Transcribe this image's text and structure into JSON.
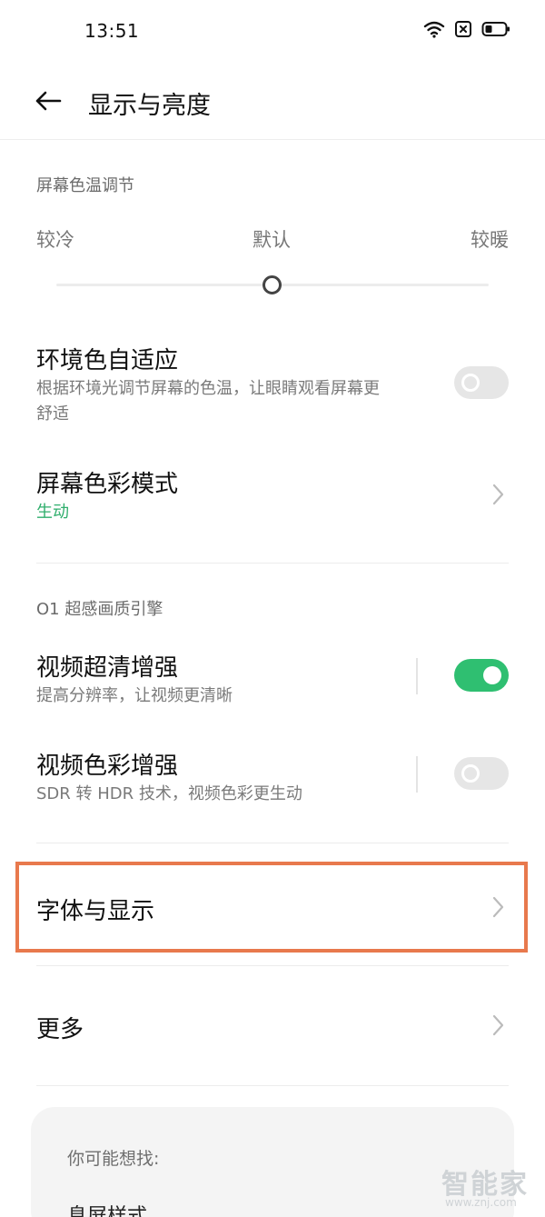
{
  "status_bar": {
    "time": "13:51",
    "icons": [
      "wifi-icon",
      "no-sim-icon",
      "battery-icon"
    ]
  },
  "header": {
    "title": "显示与亮度"
  },
  "color_temperature": {
    "section_title": "屏幕色温调节",
    "cool_label": "较冷",
    "default_label": "默认",
    "warm_label": "较暖",
    "slider_value": 0.5
  },
  "ambient_adaptive": {
    "title": "环境色自适应",
    "subtitle_line1": "根据环境光调节屏幕的色温，让眼睛观看屏幕更",
    "subtitle_line2": "舒适",
    "enabled": false
  },
  "color_mode": {
    "title": "屏幕色彩模式",
    "value": "生动"
  },
  "engine": {
    "section_title": "O1 超感画质引擎",
    "video_hd": {
      "title": "视频超清增强",
      "subtitle": "提高分辨率，让视频更清晰",
      "enabled": true
    },
    "video_color": {
      "title": "视频色彩增强",
      "subtitle": "SDR 转 HDR 技术，视频色彩更生动",
      "enabled": false
    }
  },
  "font_display": {
    "title": "字体与显示"
  },
  "more": {
    "title": "更多"
  },
  "suggestions": {
    "title": "你可能想找:",
    "first_item": "息屏样式"
  },
  "watermark": {
    "text": "智能家",
    "url": "www.znj.com"
  },
  "colors": {
    "accent_green": "#2fbf71",
    "subtitle_green": "#2fae6c",
    "highlight_orange": "#e8794d"
  }
}
